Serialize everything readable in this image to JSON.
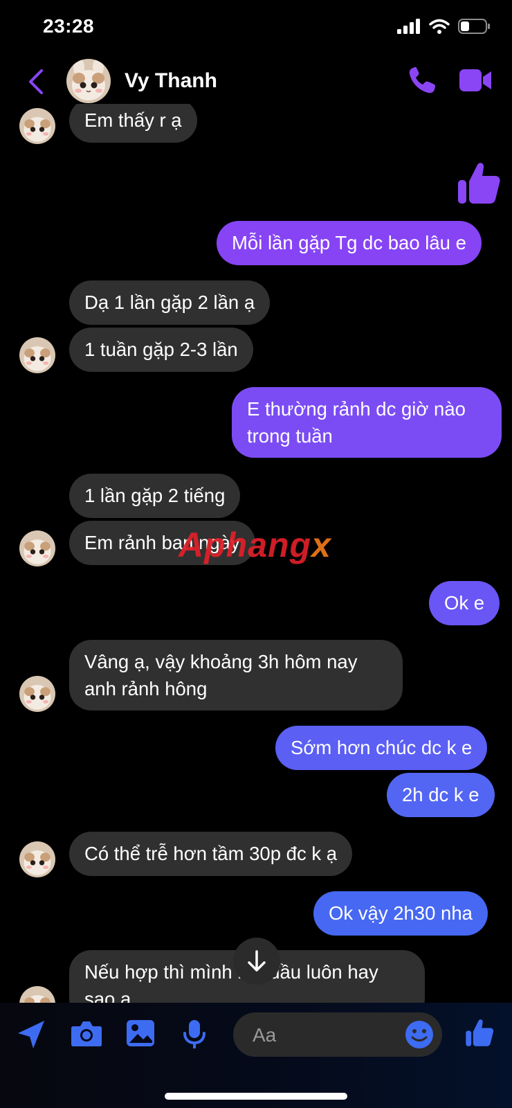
{
  "status": {
    "time": "23:28"
  },
  "header": {
    "contact_name": "Vy Thanh"
  },
  "messages": [
    {
      "text": "Em thấy r ạ",
      "sender": "them"
    },
    {
      "text": "👍",
      "sender": "me",
      "kind": "thumbs-up-sticker"
    },
    {
      "text": "Mỗi lần gặp Tg dc bao lâu e",
      "sender": "me"
    },
    {
      "text": "Dạ 1 lần gặp 2 lần ạ",
      "sender": "them"
    },
    {
      "text": "1 tuần gặp 2-3 lần",
      "sender": "them"
    },
    {
      "text": "E thường rảnh dc giờ nào\ntrong tuần",
      "sender": "me"
    },
    {
      "text": "1 lần gặp 2 tiếng",
      "sender": "them"
    },
    {
      "text": "Em rảnh ban ngày",
      "sender": "them"
    },
    {
      "text": "Ok e",
      "sender": "me"
    },
    {
      "text": "Vâng ạ, vậy khoảng 3h hôm nay\nanh rảnh hông",
      "sender": "them"
    },
    {
      "text": "Sớm hơn chúc dc k e",
      "sender": "me"
    },
    {
      "text": "2h dc k e",
      "sender": "me"
    },
    {
      "text": "Có thể trễ hơn tầm 30p đc k ạ",
      "sender": "them"
    },
    {
      "text": "Ok vậy 2h30 nha",
      "sender": "me"
    },
    {
      "text": "Nếu hợp thì mình bắt đầu luôn hay\nsao ạ",
      "sender": "them"
    }
  ],
  "watermark": {
    "part1": "Aphang",
    "part2": "x"
  },
  "composer": {
    "placeholder": "Aa"
  },
  "colors": {
    "accent": "#8a45f5",
    "bubble_in": "#303030",
    "out_top": "#8b45f5",
    "out_bottom": "#4368f2"
  }
}
